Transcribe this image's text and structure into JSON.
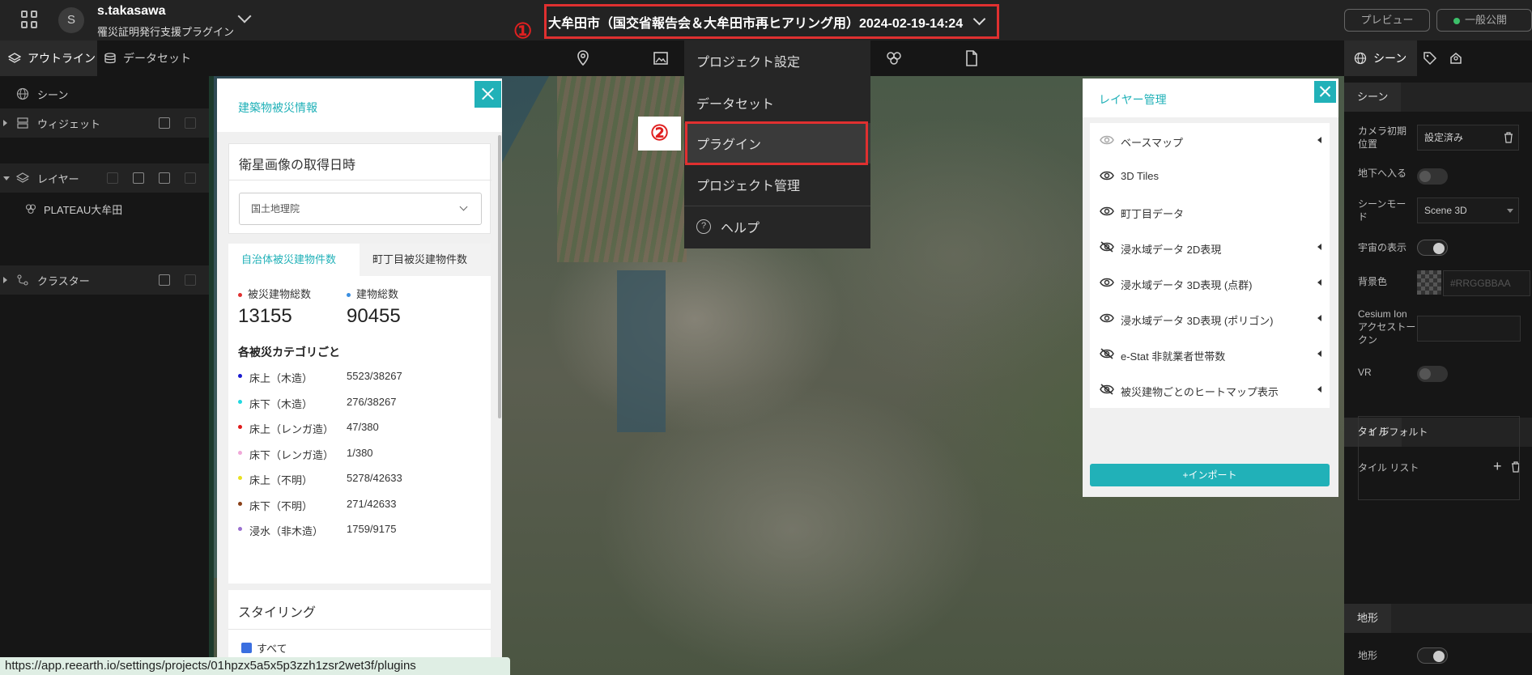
{
  "header": {
    "avatar_letter": "S",
    "user_name": "s.takasawa",
    "workspace_name": "罹災証明発行支援プラグイン",
    "project_title": "大牟田市（国交省報告会＆大牟田市再ヒアリング用）2024-02-19-14:24",
    "preview_label": "プレビュー",
    "publish_label": "一般公開",
    "publish_status_color": "#3cc06a"
  },
  "annotations": {
    "marker1": "①",
    "marker2": "②",
    "color": "#e03030"
  },
  "subbar": {
    "outline_tab": "アウトライン",
    "dataset_tab": "データセット",
    "tool_icons": [
      "map-pin-icon",
      "image-icon",
      "plugin-cube-icon",
      "document-icon"
    ],
    "right_scene_tab": "シーン",
    "right_icons": [
      "tag-icon",
      "paint-icon"
    ]
  },
  "outline": {
    "scene": "シーン",
    "widgets": "ウィジェット",
    "layers": "レイヤー",
    "layer_items": [
      "PLATEAU大牟田"
    ],
    "clusters": "クラスター"
  },
  "menu": {
    "items": [
      "プロジェクト設定",
      "データセット",
      "プラグイン",
      "プロジェクト管理",
      "ヘルプ"
    ],
    "highlighted_index": 2
  },
  "building_panel": {
    "title": "建築物被災情報",
    "capture_date_title": "衛星画像の取得日時",
    "source_select": "国土地理院",
    "tabs": [
      "自治体被災建物件数",
      "町丁目被災建物件数"
    ],
    "stats": [
      {
        "label": "被災建物総数",
        "value": "13155",
        "color": "#e03030"
      },
      {
        "label": "建物総数",
        "value": "90455",
        "color": "#3a8ee0"
      }
    ],
    "category_heading": "各被災カテゴリごと",
    "categories": [
      {
        "name": "床上（木造）",
        "value": "5523/38267",
        "color": "#1a1ad0"
      },
      {
        "name": "床下（木造）",
        "value": "276/38267",
        "color": "#20d8e0"
      },
      {
        "name": "床上（レンガ造）",
        "value": "47/380",
        "color": "#e01a1a"
      },
      {
        "name": "床下（レンガ造）",
        "value": "1/380",
        "color": "#f0a8d8"
      },
      {
        "name": "床上（不明）",
        "value": "5278/42633",
        "color": "#e8e020"
      },
      {
        "name": "床下（不明）",
        "value": "271/42633",
        "color": "#8a4018"
      },
      {
        "name": "浸水（非木造）",
        "value": "1759/9175",
        "color": "#9a70d0"
      }
    ],
    "styling_title": "スタイリング",
    "styling_check_all": "すべて"
  },
  "layer_panel": {
    "title": "レイヤー管理",
    "layers": [
      {
        "name": "ベースマップ",
        "visible": true,
        "dim": true,
        "expandable": true
      },
      {
        "name": "3D Tiles",
        "visible": true,
        "dim": false,
        "expandable": false
      },
      {
        "name": "町丁目データ",
        "visible": true,
        "dim": false,
        "expandable": false
      },
      {
        "name": "浸水域データ 2D表現",
        "visible": false,
        "dim": false,
        "expandable": true
      },
      {
        "name": "浸水域データ 3D表現 (点群)",
        "visible": true,
        "dim": false,
        "expandable": true
      },
      {
        "name": "浸水域データ 3D表現 (ポリゴン)",
        "visible": true,
        "dim": false,
        "expandable": true
      },
      {
        "name": "e-Stat 非就業者世帯数",
        "visible": false,
        "dim": false,
        "expandable": true
      },
      {
        "name": "被災建物ごとのヒートマップ表示",
        "visible": false,
        "dim": false,
        "expandable": true
      }
    ],
    "import_label": "+インポート"
  },
  "scene_props": {
    "section_scene": "シーン",
    "camera_label": "カメラ初期位置",
    "camera_value": "設定済み",
    "underground_label": "地下へ入る",
    "scene_mode_label": "シーンモード",
    "scene_mode_value": "Scene 3D",
    "space_label": "宇宙の表示",
    "bg_color_label": "背景色",
    "bg_color_placeholder": "#RRGGBBAA",
    "cesium_label": "Cesium Ion アクセストークン",
    "vr_label": "VR",
    "section_tile": "タイル",
    "tile_list_label": "タイル リスト",
    "tile_items": [
      {
        "index": "1",
        "name": "デフォルト"
      }
    ],
    "section_terrain": "地形",
    "terrain_label": "地形"
  },
  "status_url": "https://app.reearth.io/settings/projects/01hpzx5a5x5p3zzh1zsr2wet3f/plugins",
  "accent_color": "#21b1b8"
}
